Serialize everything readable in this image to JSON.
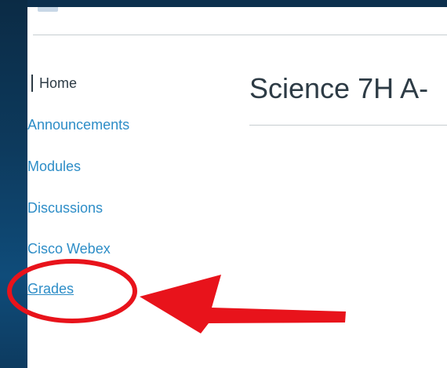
{
  "course_nav": {
    "items": [
      {
        "label": "Home",
        "state": "active"
      },
      {
        "label": "Announcements",
        "state": "link"
      },
      {
        "label": "Modules",
        "state": "link"
      },
      {
        "label": "Discussions",
        "state": "link"
      },
      {
        "label": "Cisco Webex",
        "state": "link"
      },
      {
        "label": "Grades",
        "state": "link-underlined"
      }
    ]
  },
  "main": {
    "title": "Science 7H A-"
  },
  "annotation": {
    "color": "#e8131b",
    "shapes": [
      "circle",
      "arrow"
    ],
    "target": "Grades"
  },
  "colors": {
    "link": "#2d8dc7",
    "text": "#2d3b45",
    "rail": "#0d3a5d"
  }
}
